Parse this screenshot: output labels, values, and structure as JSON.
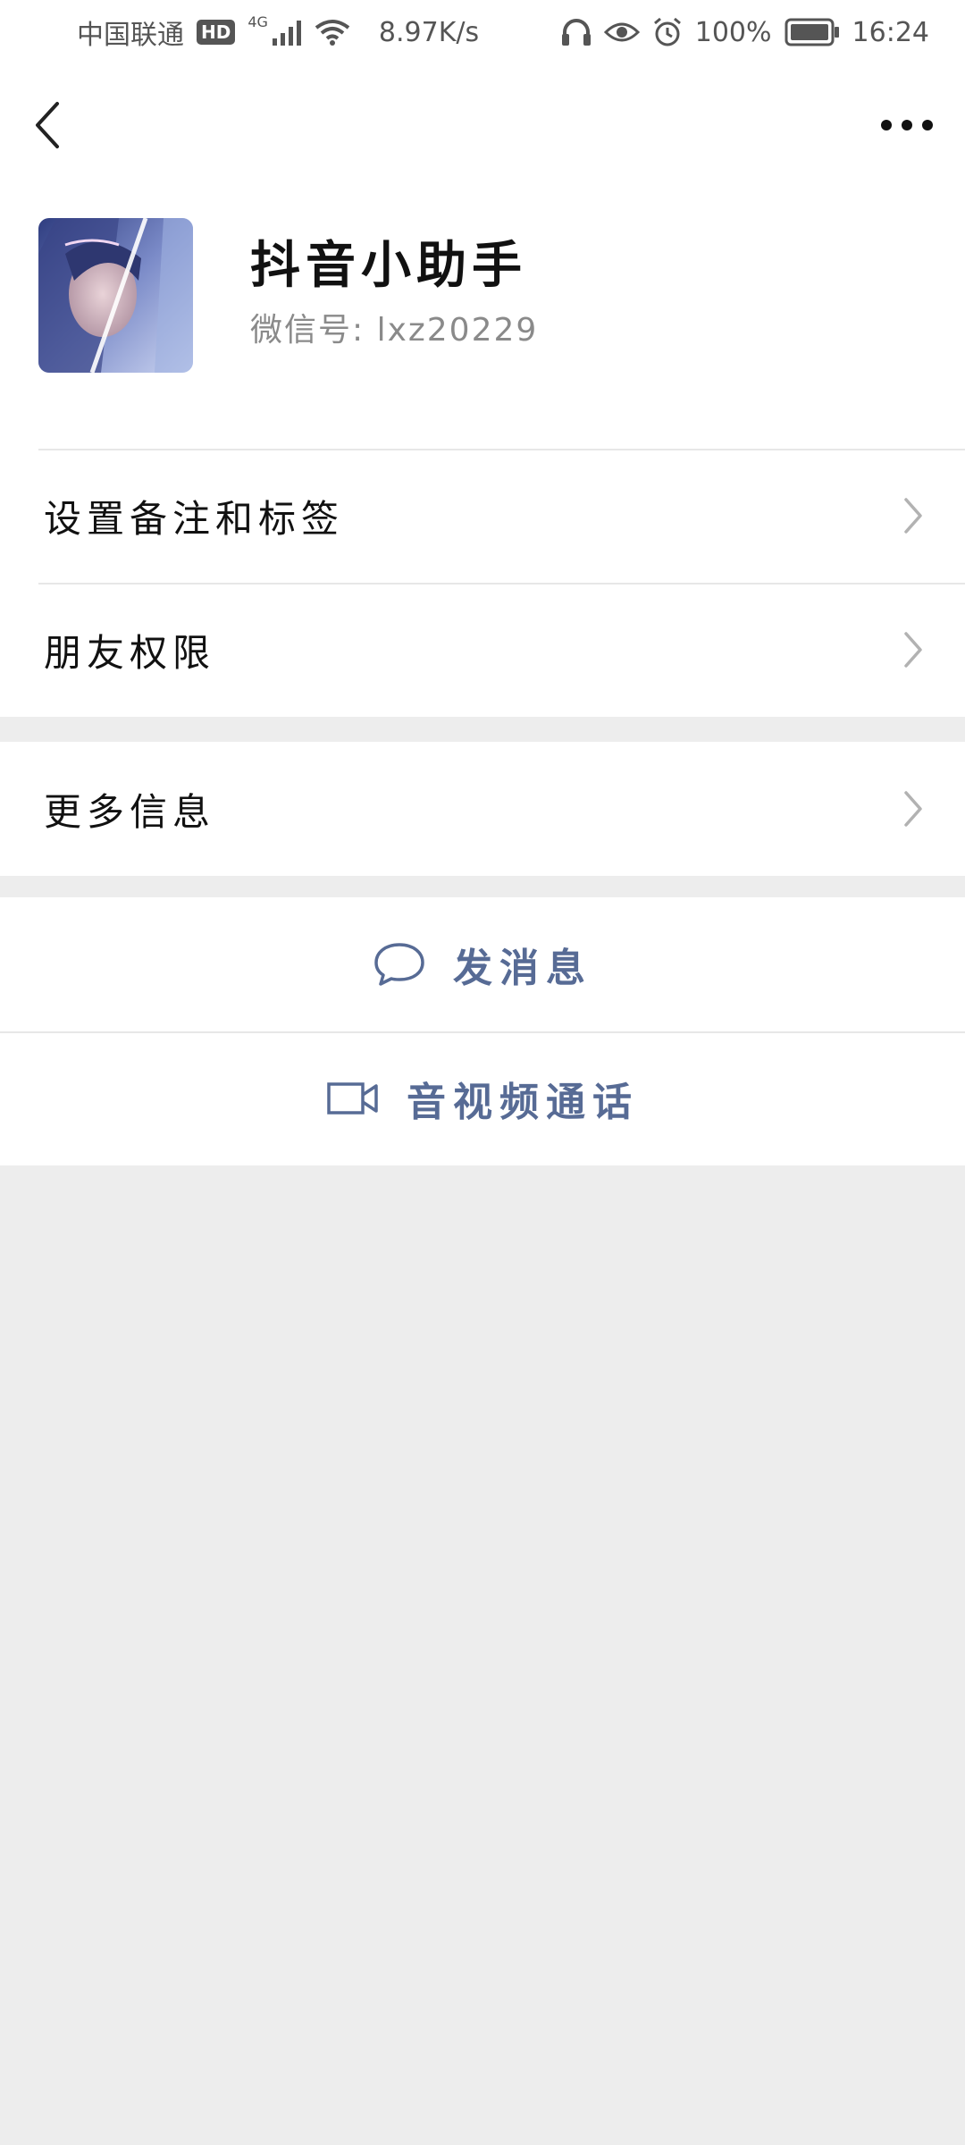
{
  "status_bar": {
    "carrier": "中国联通",
    "hd_badge": "HD",
    "network": "4G",
    "speed": "8.97K/s",
    "battery": "100%",
    "time": "16:24"
  },
  "profile": {
    "name": "抖音小助手",
    "wechat_id": "微信号: lxz20229"
  },
  "menu": {
    "remark_tags": "设置备注和标签",
    "friend_permissions": "朋友权限",
    "more_info": "更多信息"
  },
  "actions": {
    "send_message": "发消息",
    "video_call": "音视频通话"
  },
  "colors": {
    "link": "#576b95",
    "background": "#ededed"
  },
  "icons": [
    "back-arrow-icon",
    "more-dots-icon",
    "chevron-right-icon",
    "chat-bubble-icon",
    "video-camera-icon"
  ]
}
